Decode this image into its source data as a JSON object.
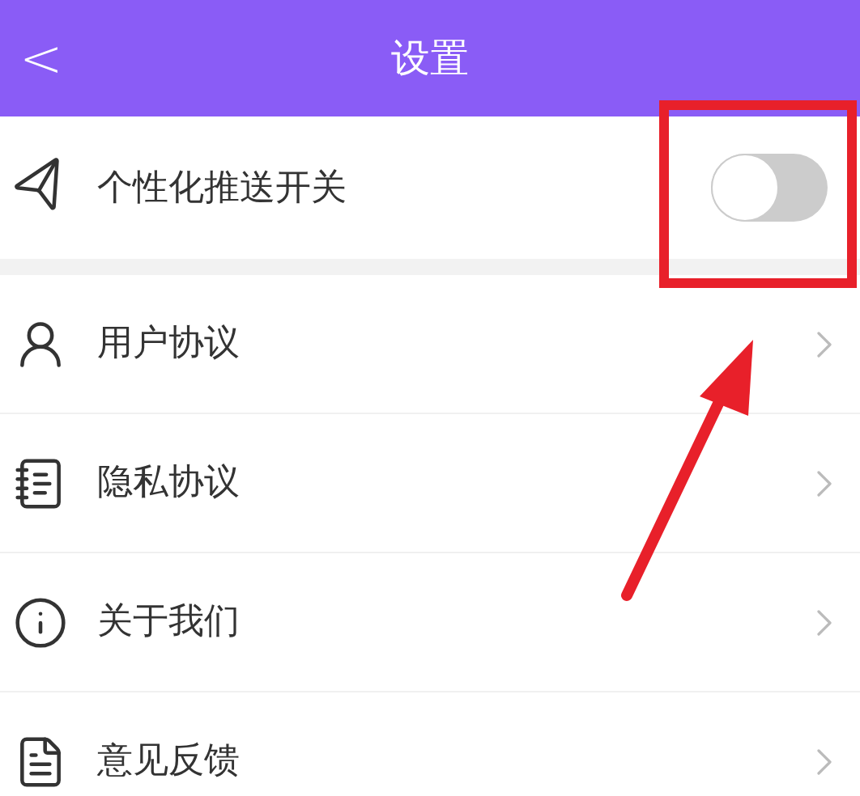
{
  "header": {
    "back": "<",
    "title": "设置"
  },
  "push_setting": {
    "label": "个性化推送开关",
    "on": false
  },
  "menu": [
    {
      "kind": "user",
      "label": "用户协议"
    },
    {
      "kind": "privacy",
      "label": "隐私协议"
    },
    {
      "kind": "about",
      "label": "关于我们"
    },
    {
      "kind": "feedback",
      "label": "意见反馈"
    }
  ]
}
